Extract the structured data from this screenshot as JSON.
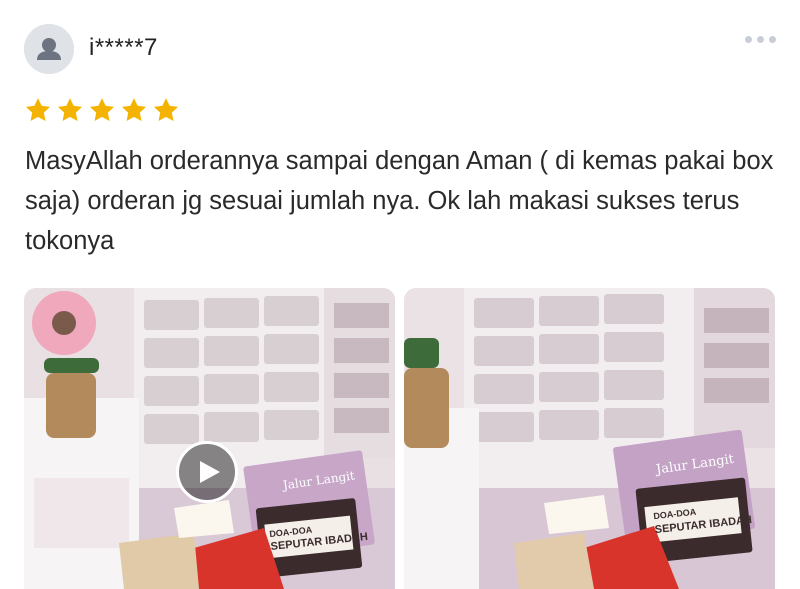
{
  "review": {
    "username": "i*****7",
    "rating": 5,
    "rating_max": 5,
    "text": "MasyAllah orderannya sampai dengan Aman ( di kemas pakai box saja) orderan jg sesuai jumlah nya. Ok lah makasi sukses terus tokonya",
    "media": [
      {
        "type": "video",
        "book_cover_title": "Jalur Langit",
        "book_title": "SEPUTAR IBADAH",
        "book_subtitle": "DOA-DOA"
      },
      {
        "type": "image",
        "book_cover_title": "Jalur Langit",
        "book_title": "SEPUTAR IBADAH",
        "book_subtitle": "DOA-DOA"
      }
    ]
  },
  "icons": {
    "avatar": "user-silhouette-icon",
    "more": "more-dots-icon",
    "star": "star-filled-icon",
    "play": "play-icon"
  },
  "colors": {
    "star": "#f5b301",
    "avatar_bg": "#dfe3e8",
    "avatar_fg": "#6b7480",
    "text": "#2a2a2a",
    "more_dots": "#c9ced6"
  }
}
